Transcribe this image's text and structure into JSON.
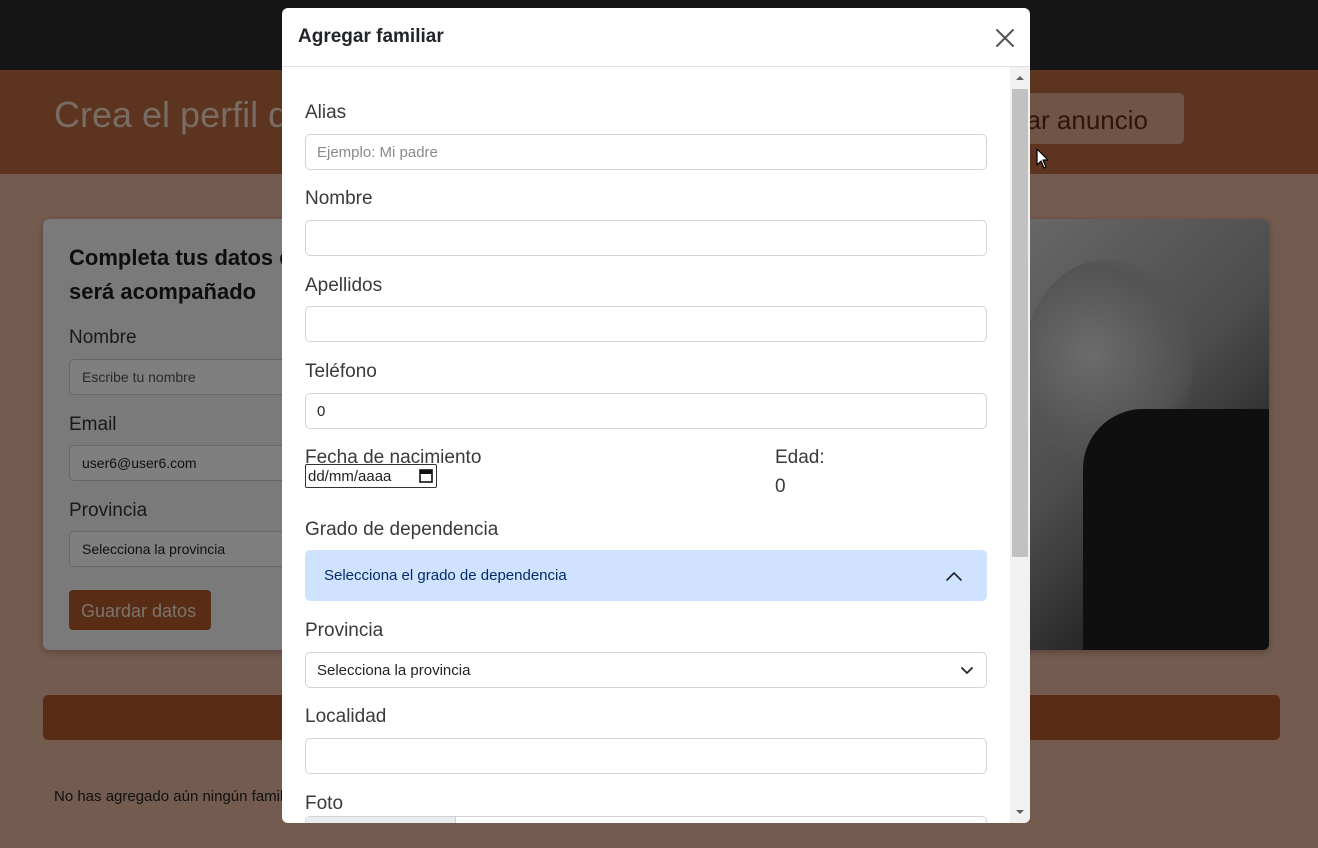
{
  "background": {
    "hero_title": "Crea el perfil d",
    "publish_button": "licar anuncio",
    "card_heading": "Completa tus datos d será acompañado",
    "name_label": "Nombre",
    "name_placeholder": "Escribe tu nombre",
    "email_label": "Email",
    "email_value": "user6@user6.com",
    "province_label": "Provincia",
    "province_value": "Selecciona la provincia",
    "save_button": "Guardar datos",
    "empty_message": "No has agregado aún ningún famil"
  },
  "modal": {
    "title": "Agregar familiar",
    "alias_label": "Alias",
    "alias_placeholder": "Ejemplo: Mi padre",
    "nombre_label": "Nombre",
    "nombre_value": "",
    "apellidos_label": "Apellidos",
    "apellidos_value": "",
    "telefono_label": "Teléfono",
    "telefono_value": "0",
    "fecha_label": "Fecha de nacimiento",
    "fecha_placeholder": "dd/mm/aaaa",
    "edad_label": "Edad:",
    "edad_value": "0",
    "grado_label": "Grado de dependencia",
    "grado_value": "Selecciona el grado de dependencia",
    "provincia_label": "Provincia",
    "provincia_value": "Selecciona la provincia",
    "localidad_label": "Localidad",
    "localidad_value": "",
    "foto_label": "Foto"
  },
  "colors": {
    "brand": "#b0592b",
    "select_focus": "#cfe2ff"
  }
}
